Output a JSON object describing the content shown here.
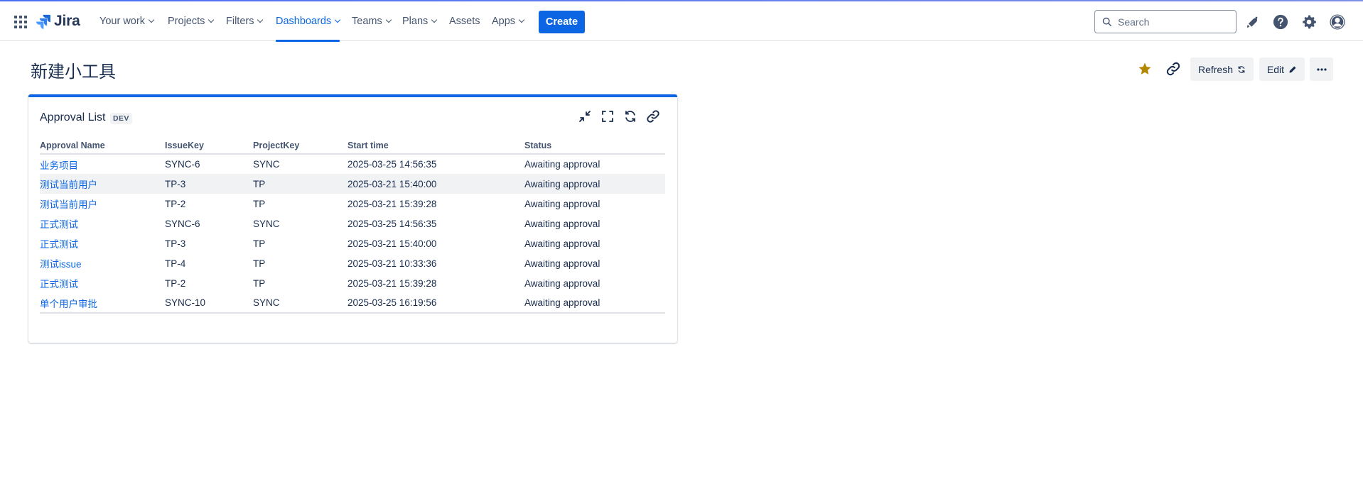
{
  "nav": {
    "logo_text": "Jira",
    "items": [
      {
        "label": "Your work",
        "dropdown": true
      },
      {
        "label": "Projects",
        "dropdown": true
      },
      {
        "label": "Filters",
        "dropdown": true
      },
      {
        "label": "Dashboards",
        "dropdown": true,
        "active": true
      },
      {
        "label": "Teams",
        "dropdown": true
      },
      {
        "label": "Plans",
        "dropdown": true
      },
      {
        "label": "Assets",
        "dropdown": false
      },
      {
        "label": "Apps",
        "dropdown": true
      }
    ],
    "create_label": "Create",
    "search_placeholder": "Search",
    "accent_color": "#0c66e4"
  },
  "page": {
    "title": "新建小工具",
    "refresh_label": "Refresh",
    "edit_label": "Edit",
    "star_color": "#b38600"
  },
  "gadget": {
    "title": "Approval List",
    "badge": "DEV",
    "columns": [
      "Approval Name",
      "IssueKey",
      "ProjectKey",
      "Start time",
      "Status"
    ],
    "rows": [
      {
        "name": "业务项目",
        "issue": "SYNC-6",
        "project": "SYNC",
        "start": "2025-03-25 14:56:35",
        "status": "Awaiting approval"
      },
      {
        "name": "测试当前用户",
        "issue": "TP-3",
        "project": "TP",
        "start": "2025-03-21 15:40:00",
        "status": "Awaiting approval"
      },
      {
        "name": "测试当前用户",
        "issue": "TP-2",
        "project": "TP",
        "start": "2025-03-21 15:39:28",
        "status": "Awaiting approval"
      },
      {
        "name": "正式测试",
        "issue": "SYNC-6",
        "project": "SYNC",
        "start": "2025-03-25 14:56:35",
        "status": "Awaiting approval"
      },
      {
        "name": "正式测试",
        "issue": "TP-3",
        "project": "TP",
        "start": "2025-03-21 15:40:00",
        "status": "Awaiting approval"
      },
      {
        "name": "测试issue",
        "issue": "TP-4",
        "project": "TP",
        "start": "2025-03-21 10:33:36",
        "status": "Awaiting approval"
      },
      {
        "name": "正式测试",
        "issue": "TP-2",
        "project": "TP",
        "start": "2025-03-21 15:39:28",
        "status": "Awaiting approval"
      },
      {
        "name": "单个用户审批",
        "issue": "SYNC-10",
        "project": "SYNC",
        "start": "2025-03-25 16:19:56",
        "status": "Awaiting approval"
      }
    ]
  }
}
